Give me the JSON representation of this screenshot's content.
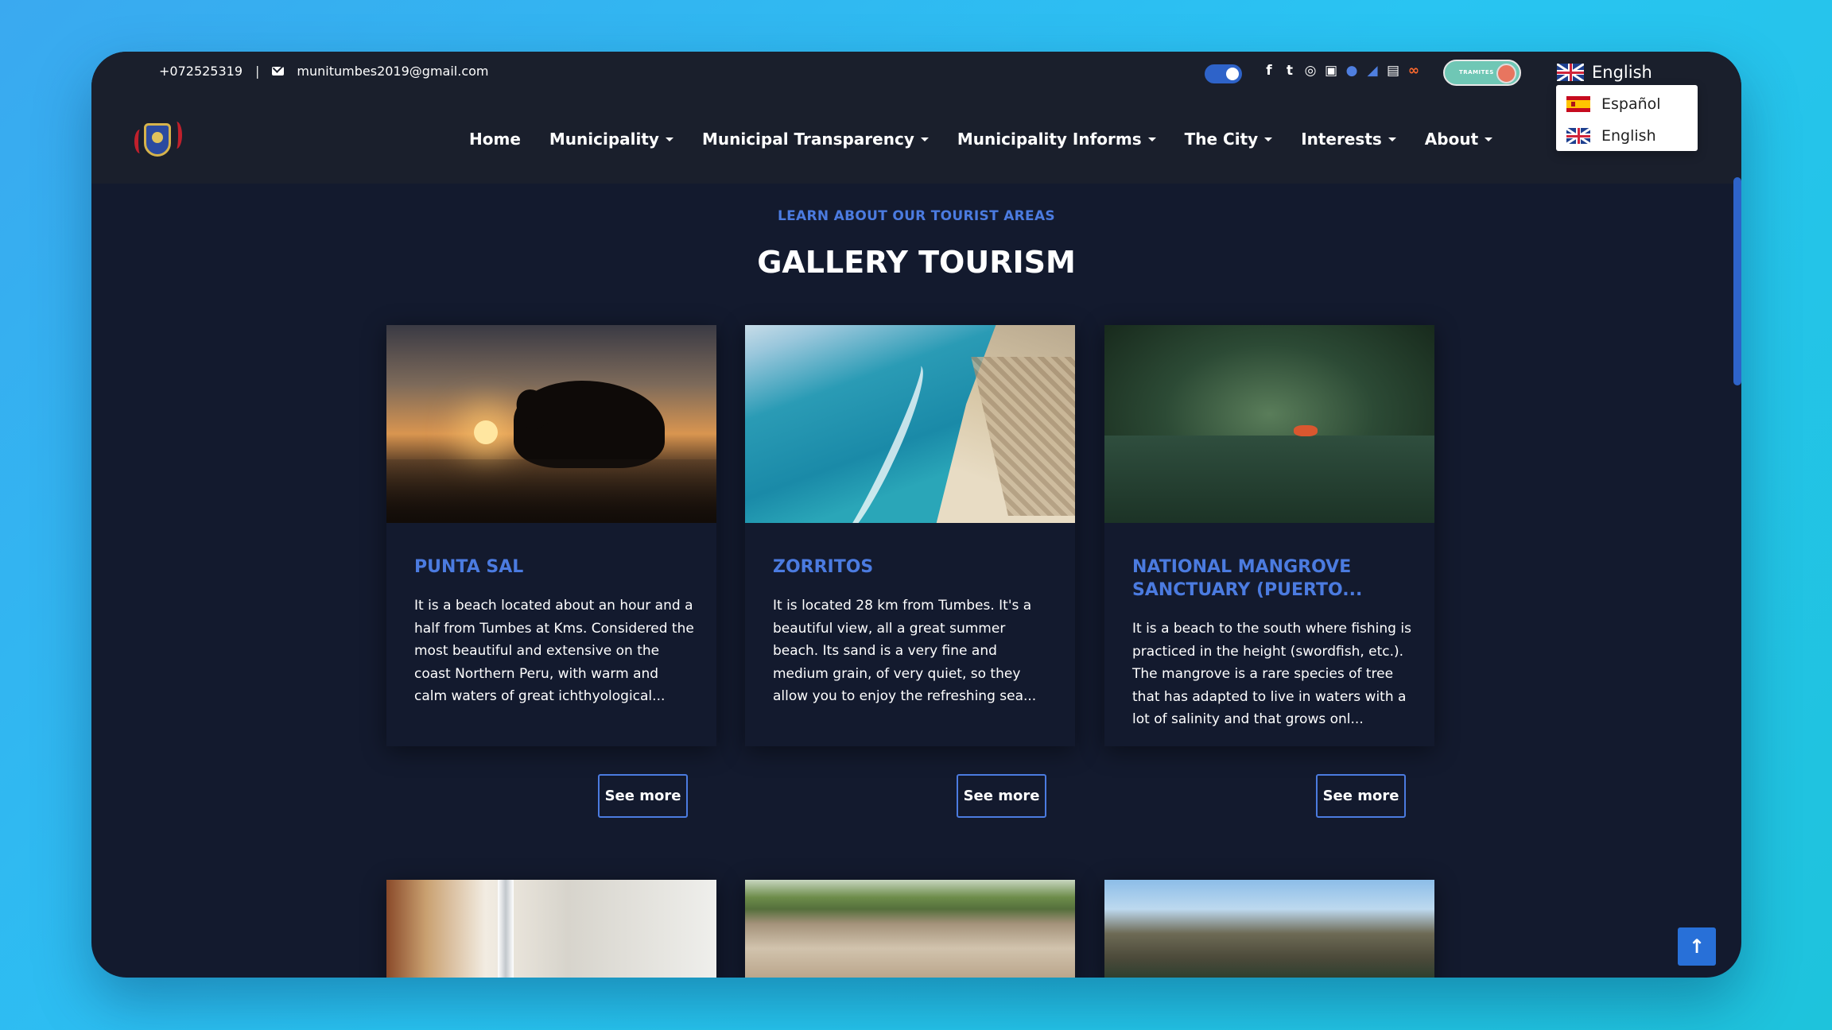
{
  "topbar": {
    "phone": "+072525319",
    "separator": "|",
    "email": "munitumbes2019@gmail.com",
    "tramites_label": "TRAMITES",
    "social_icons": [
      "facebook-icon",
      "twitter-icon",
      "instagram-icon",
      "youtube-icon",
      "chat-icon",
      "phone-icon",
      "archive-icon",
      "link-icon"
    ]
  },
  "language": {
    "current": "English",
    "options": [
      "Español",
      "English"
    ]
  },
  "nav": {
    "items": [
      "Home",
      "Municipality",
      "Municipal Transparency",
      "Municipality Informs",
      "The City",
      "Interests",
      "About"
    ]
  },
  "section": {
    "eyebrow": "LEARN ABOUT OUR TOURIST AREAS",
    "title": "GALLERY TOURISM"
  },
  "cards": [
    {
      "title": "PUNTA SAL",
      "description": "It is a beach located about an hour and a half from Tumbes at Kms. Considered the most beautiful and extensive on the coast Northern Peru, with warm and calm waters of great ichthyological...",
      "button": "See more"
    },
    {
      "title": "ZORRITOS",
      "description": "It is located 28 km from Tumbes. It's a beautiful view, all a great summer beach. Its sand is a very fine and medium grain, of very quiet, so they allow you to enjoy the refreshing sea...",
      "button": "See more"
    },
    {
      "title": "NATIONAL MANGROVE SANCTUARY (PUERTO...",
      "description": "It is a beach to the south where fishing is practiced in the height (swordfish, etc.). The mangrove is a rare species of tree that has adapted to live in waters with a lot of salinity and that grows onl...",
      "button": "See more"
    }
  ],
  "colors": {
    "accent": "#4b7be0",
    "background": "#131a2e",
    "header": "#1a1f2c"
  },
  "scroll_top_label": "↑"
}
